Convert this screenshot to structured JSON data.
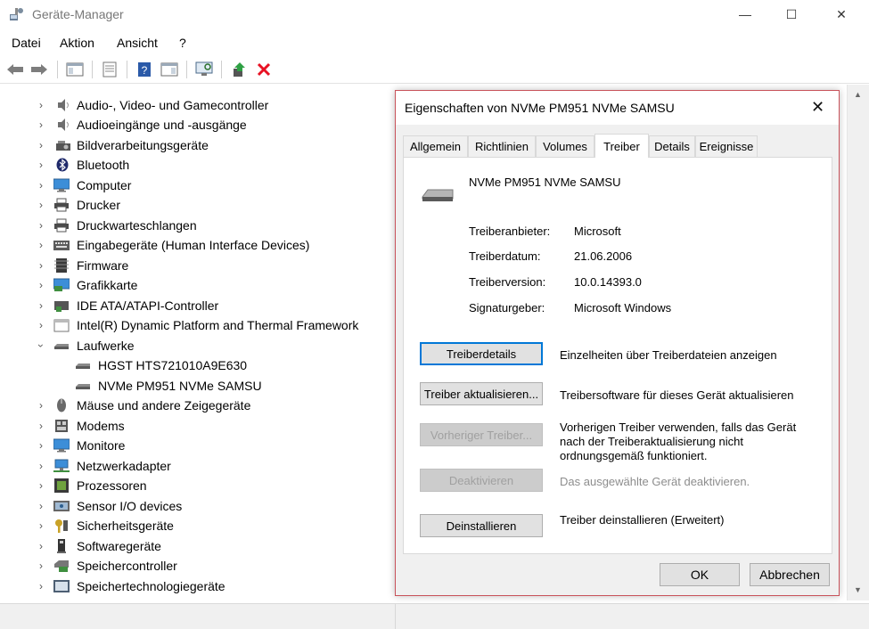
{
  "window": {
    "title": "Geräte-Manager",
    "minimize": "—",
    "maximize": "☐",
    "close": "✕"
  },
  "menu": [
    "Datei",
    "Aktion",
    "Ansicht",
    "?"
  ],
  "tree": {
    "items": [
      {
        "label": "Audio-, Video- und Gamecontroller",
        "icon": "speaker-icon",
        "expanded": false
      },
      {
        "label": "Audioeingänge und -ausgänge",
        "icon": "speaker-icon",
        "expanded": false
      },
      {
        "label": "Bildverarbeitungsgeräte",
        "icon": "camera-icon",
        "expanded": false
      },
      {
        "label": "Bluetooth",
        "icon": "bluetooth-icon",
        "expanded": false
      },
      {
        "label": "Computer",
        "icon": "monitor-icon",
        "expanded": false
      },
      {
        "label": "Drucker",
        "icon": "printer-icon",
        "expanded": false
      },
      {
        "label": "Druckwarteschlangen",
        "icon": "printer-icon",
        "expanded": false
      },
      {
        "label": "Eingabegeräte (Human Interface Devices)",
        "icon": "keyboard-icon",
        "expanded": false
      },
      {
        "label": "Firmware",
        "icon": "chip-icon",
        "expanded": false
      },
      {
        "label": "Grafikkarte",
        "icon": "display-adapter-icon",
        "expanded": false
      },
      {
        "label": "IDE ATA/ATAPI-Controller",
        "icon": "controller-icon",
        "expanded": false
      },
      {
        "label": "Intel(R) Dynamic Platform and Thermal Framework",
        "icon": "folder-icon",
        "expanded": false
      },
      {
        "label": "Laufwerke",
        "icon": "drive-icon",
        "expanded": true
      },
      {
        "label": "HGST HTS721010A9E630",
        "icon": "drive-icon",
        "child": true
      },
      {
        "label": "NVMe PM951 NVMe SAMSU",
        "icon": "drive-icon",
        "child": true
      },
      {
        "label": "Mäuse und andere Zeigegeräte",
        "icon": "mouse-icon",
        "expanded": false
      },
      {
        "label": "Modems",
        "icon": "modem-icon",
        "expanded": false
      },
      {
        "label": "Monitore",
        "icon": "monitor-icon",
        "expanded": false
      },
      {
        "label": "Netzwerkadapter",
        "icon": "network-icon",
        "expanded": false
      },
      {
        "label": "Prozessoren",
        "icon": "cpu-icon",
        "expanded": false
      },
      {
        "label": "Sensor I/O devices",
        "icon": "sensor-icon",
        "expanded": false
      },
      {
        "label": "Sicherheitsgeräte",
        "icon": "key-icon",
        "expanded": false
      },
      {
        "label": "Softwaregeräte",
        "icon": "software-device-icon",
        "expanded": false
      },
      {
        "label": "Speichercontroller",
        "icon": "storage-controller-icon",
        "expanded": false
      },
      {
        "label": "Speichertechnologiegeräte",
        "icon": "memory-card-icon",
        "expanded": false
      }
    ]
  },
  "dialog": {
    "title": "Eigenschaften von NVMe PM951 NVMe SAMSU",
    "close": "✕",
    "tabs": [
      "Allgemein",
      "Richtlinien",
      "Volumes",
      "Treiber",
      "Details",
      "Ereignisse"
    ],
    "active_tab": "Treiber",
    "device_name": "NVMe PM951 NVMe SAMSU",
    "properties": [
      {
        "label": "Treiberanbieter:",
        "value": "Microsoft"
      },
      {
        "label": "Treiberdatum:",
        "value": "21.06.2006"
      },
      {
        "label": "Treiberversion:",
        "value": "10.0.14393.0"
      },
      {
        "label": "Signaturgeber:",
        "value": "Microsoft Windows"
      }
    ],
    "actions": [
      {
        "button": "Treiberdetails",
        "description": "Einzelheiten über Treiberdateien anzeigen",
        "enabled": true,
        "focused": true
      },
      {
        "button": "Treiber aktualisieren...",
        "description": "Treibersoftware für dieses Gerät aktualisieren",
        "enabled": true
      },
      {
        "button": "Vorheriger Treiber...",
        "description": "Vorherigen Treiber verwenden, falls das Gerät nach der Treiberaktualisierung nicht ordnungsgemäß funktioniert.",
        "enabled": false
      },
      {
        "button": "Deaktivieren",
        "description": "Das ausgewählte Gerät deaktivieren.",
        "enabled": false
      },
      {
        "button": "Deinstallieren",
        "description": "Treiber deinstallieren (Erweitert)",
        "enabled": true
      }
    ],
    "ok": "OK",
    "cancel": "Abbrechen"
  },
  "colors": {
    "accent": "#0078d7",
    "dialog_border": "#c8525a",
    "delete_red": "#e81123"
  }
}
